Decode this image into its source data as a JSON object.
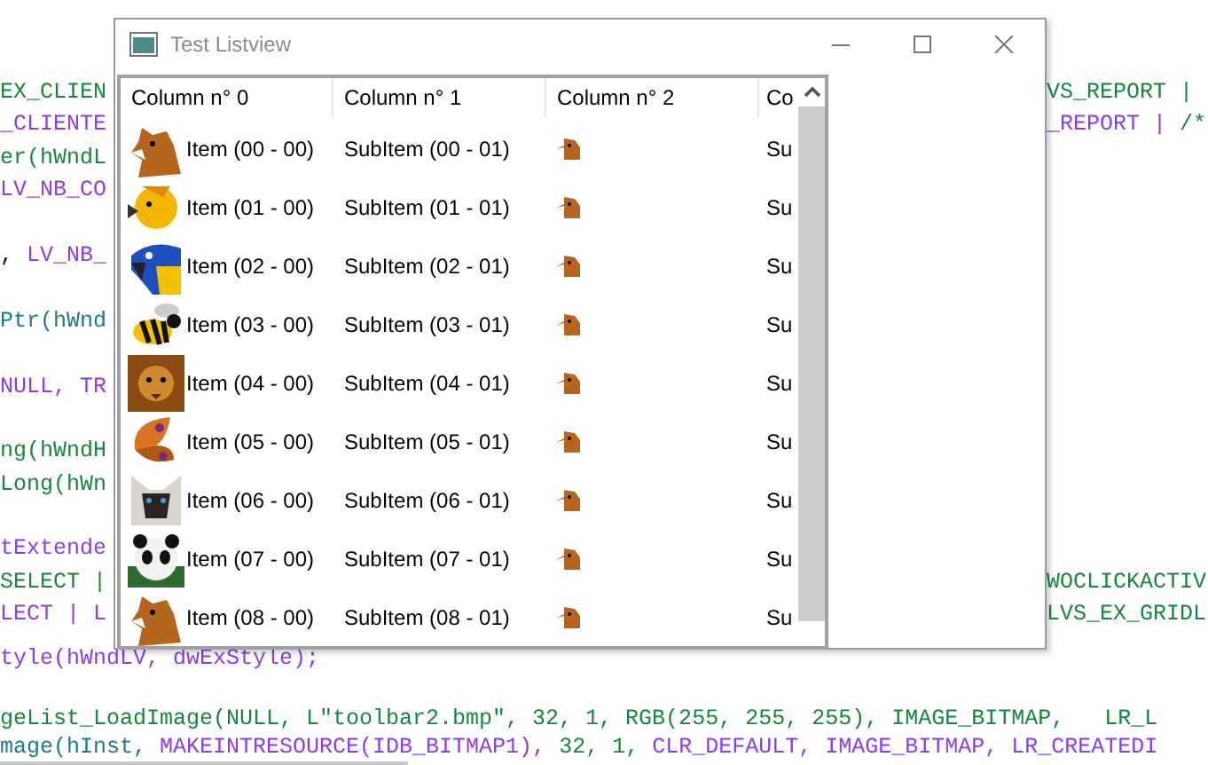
{
  "window": {
    "title": "Test Listview"
  },
  "listview": {
    "columns": [
      "Column n° 0",
      "Column n° 1",
      "Column n° 2",
      "Co"
    ],
    "rows": [
      {
        "item": "Item (00 - 00)",
        "subitem": "SubItem (00 - 01)",
        "column_3": "Su"
      },
      {
        "item": "Item (01 - 00)",
        "subitem": "SubItem (01 - 01)",
        "column_3": "Su"
      },
      {
        "item": "Item (02 - 00)",
        "subitem": "SubItem (02 - 01)",
        "column_3": "Su"
      },
      {
        "item": "Item (03 - 00)",
        "subitem": "SubItem (03 - 01)",
        "column_3": "Su"
      },
      {
        "item": "Item (04 - 00)",
        "subitem": "SubItem (04 - 01)",
        "column_3": "Su"
      },
      {
        "item": "Item (05 - 00)",
        "subitem": "SubItem (05 - 01)",
        "column_3": "Su"
      },
      {
        "item": "Item (06 - 00)",
        "subitem": "SubItem (06 - 01)",
        "column_3": "Su"
      },
      {
        "item": "Item (07 - 00)",
        "subitem": "SubItem (07 - 01)",
        "column_3": "Su"
      },
      {
        "item": "Item (08 - 00)",
        "subitem": "SubItem (08 - 01)",
        "column_3": "Su"
      }
    ]
  },
  "code_lines": [
    {
      "left": [
        {
          "text": "EX_CLIEN",
          "color": "#16873a"
        }
      ],
      "right": [
        {
          "text": "VS_REPORT |",
          "color": "#16873a"
        }
      ]
    },
    {
      "left": [
        {
          "text": "_CLIENTE",
          "color": "#8b3cf0"
        }
      ],
      "right": [
        {
          "text": "_REPORT |",
          "color": "#8b3cf0"
        },
        {
          "text": "/*",
          "color": "#16873a"
        }
      ]
    },
    {
      "left": [
        {
          "text": "er(hWndL",
          "color": "#16873a"
        }
      ]
    },
    {
      "left": [
        {
          "text": "LV_NB_CO",
          "color": "#8b3cf0"
        }
      ]
    },
    {
      "left": [
        {
          "text": ",",
          "color": "#000000"
        },
        {
          "text": "LV_NB_",
          "color": "#8b3cf0"
        }
      ]
    },
    {
      "left": [
        {
          "text": "Ptr(hWnd",
          "color": "#1c7a8a"
        }
      ]
    },
    {
      "left": [
        {
          "text": "NULL, TR",
          "color": "#8b3cf0"
        }
      ]
    },
    {
      "left": [
        {
          "text": "ng(hWndH",
          "color": "#16873a"
        }
      ]
    },
    {
      "left": [
        {
          "text": "Long(hWn",
          "color": "#16873a"
        }
      ]
    },
    {
      "left": [
        {
          "text": "tExtende",
          "color": "#8b3cf0"
        }
      ]
    },
    {
      "left": [
        {
          "text": "SELECT |",
          "color": "#16873a"
        }
      ],
      "right": [
        {
          "text": "WOCLICKACTIV",
          "color": "#16873a"
        }
      ]
    },
    {
      "left": [
        {
          "text": "LECT | L",
          "color": "#8b3cf0"
        }
      ],
      "right": [
        {
          "text": "LVS_EX_GRIDL",
          "color": "#16873a"
        }
      ]
    },
    {
      "left": [
        {
          "text": "tyle(hWndLV, dwExStyle);",
          "color": "#8b3cf0"
        }
      ]
    },
    {
      "left": [
        {
          "text": "geList_LoadImage(NULL, L\"toolbar2.bmp\", 32, 1, RGB(255, 255, 255), IMAGE_BITMAP,   LR_L",
          "color": "#16873a"
        }
      ]
    },
    {
      "left": [
        {
          "text": "mage(hInst,",
          "color": "#1c7a8a"
        },
        {
          "text": "MAKEINTRESOURCE(IDB_BITMAP1),",
          "color": "#8b3cf0"
        },
        {
          "text": "32, 1,",
          "color": "#16873a"
        },
        {
          "text": "CLR_DEFAULT, IMAGE_BITMAP, LR_CREATEDI",
          "color": "#8b3cf0"
        }
      ]
    }
  ]
}
